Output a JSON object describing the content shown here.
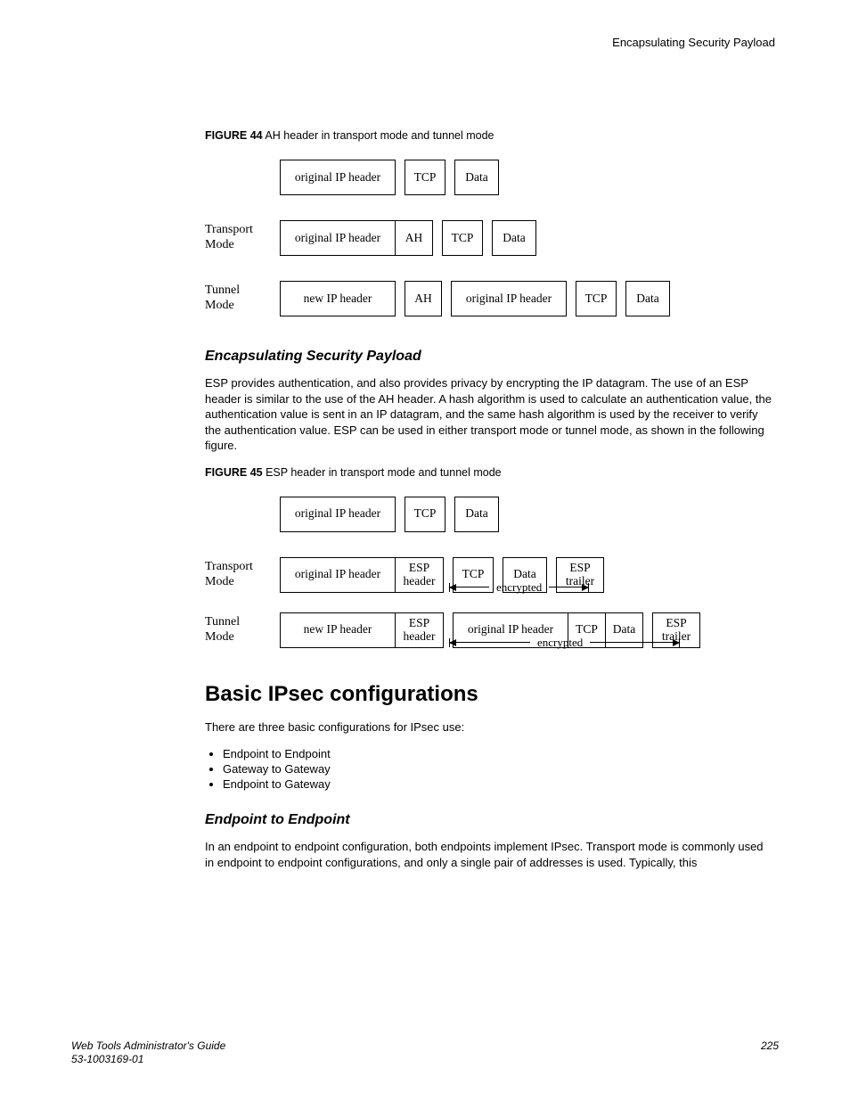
{
  "header": {
    "running": "Encapsulating Security Payload"
  },
  "fig44": {
    "label": "FIGURE 44",
    "caption": "AH header in transport mode and tunnel mode",
    "row1": {
      "c1": "original IP header",
      "c2": "TCP",
      "c3": "Data"
    },
    "row2": {
      "label": "Transport\nMode",
      "c1": "original IP header",
      "c2": "AH",
      "c3": "TCP",
      "c4": "Data"
    },
    "row3": {
      "label": "Tunnel\nMode",
      "c1": "new IP header",
      "c2": "AH",
      "c3": "original IP header",
      "c4": "TCP",
      "c5": "Data"
    }
  },
  "esp": {
    "heading": "Encapsulating Security Payload",
    "para": "ESP provides authentication, and also provides privacy by encrypting the IP datagram. The use of an ESP header is similar to the use of the AH header. A hash algorithm is used to calculate an authentication value, the authentication value is sent in an IP datagram, and the same hash algorithm is used by the receiver to verify the authentication value. ESP can be used in either transport mode or tunnel mode, as shown in the following figure."
  },
  "fig45": {
    "label": "FIGURE 45",
    "caption": "ESP header in transport mode and tunnel mode",
    "row1": {
      "c1": "original IP header",
      "c2": "TCP",
      "c3": "Data"
    },
    "row2": {
      "label": "Transport\nMode",
      "c1": "original IP header",
      "c2a": "ESP",
      "c2b": "header",
      "c3": "TCP",
      "c4": "Data",
      "c5a": "ESP",
      "c5b": "trailer",
      "enc": "encrypted"
    },
    "row3": {
      "label": "Tunnel\nMode",
      "c1": "new IP header",
      "c2a": "ESP",
      "c2b": "header",
      "c3": "original IP header",
      "c4": "TCP",
      "c5": "Data",
      "c6a": "ESP",
      "c6b": "trailer",
      "enc": "encrypted"
    }
  },
  "basic": {
    "heading": "Basic IPsec configurations",
    "intro": "There are three basic configurations for IPsec use:",
    "items": [
      "Endpoint to Endpoint",
      "Gateway to Gateway",
      "Endpoint to Gateway"
    ]
  },
  "ep": {
    "heading": "Endpoint to Endpoint",
    "para": "In an endpoint to endpoint configuration, both endpoints implement IPsec. Transport mode is commonly used in endpoint to endpoint configurations, and only a single pair of addresses is used. Typically, this"
  },
  "footer": {
    "title": "Web Tools Administrator's Guide",
    "docnum": "53-1003169-01",
    "pagenum": "225"
  }
}
